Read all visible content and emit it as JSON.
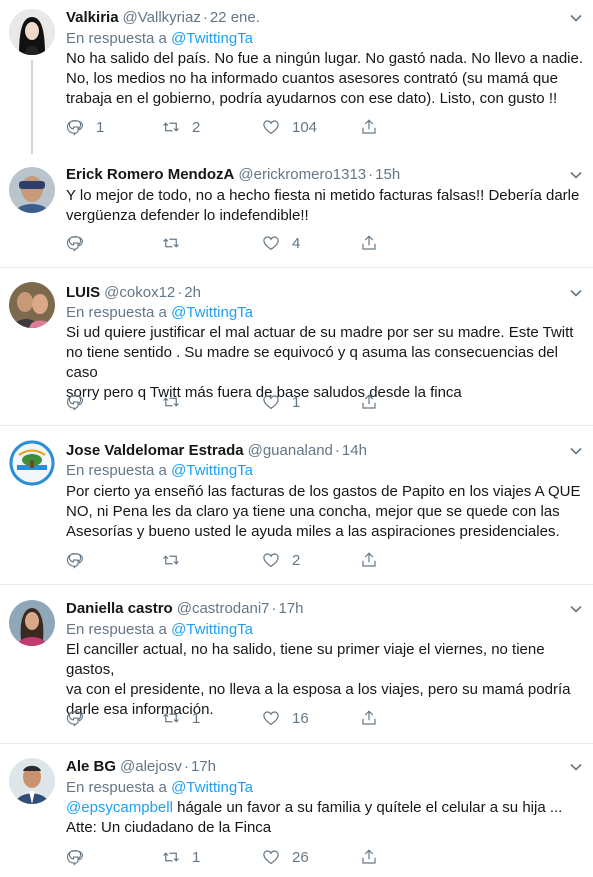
{
  "reply_prefix": "En respuesta a",
  "tweets": [
    {
      "name": "Valkiria",
      "handle": "@Vallkyriaz",
      "time": "22 ene.",
      "reply_to": "@TwittingTa",
      "text": "No ha salido del país. No fue a ningún lugar. No gastó nada. No llevo a nadie.\nNo, los medios no ha informado cuantos asesores contrató (su mamá que\ntrabaja en el gobierno, podría ayudarnos con ese dato). Listo, con gusto !!",
      "replies": "1",
      "retweets": "2",
      "likes": "104"
    },
    {
      "name": "Erick Romero MendozA",
      "handle": "@erickromero1313",
      "time": "15h",
      "text": "Y lo mejor de todo, no a hecho fiesta ni metido facturas falsas!! Debería darle\nvergüenza defender lo indefendible!!",
      "replies": "",
      "retweets": "",
      "likes": "4"
    },
    {
      "name": "LUIS",
      "handle": "@cokox12",
      "time": "2h",
      "reply_to": "@TwittingTa",
      "text": "Si ud quiere justificar el mal actuar de su madre por ser su madre. Este Twitt\nno tiene sentido . Su madre se equivocó y q asuma las consecuencias del caso\nsorry pero q Twitt más fuera de base saludos desde la finca",
      "replies": "",
      "retweets": "",
      "likes": "1"
    },
    {
      "name": "Jose Valdelomar Estrada",
      "handle": "@guanaland",
      "time": "14h",
      "reply_to": "@TwittingTa",
      "text": "Por cierto ya enseñó las facturas de los gastos de Papito en los viajes A QUE\nNO, ni Pena les da claro ya tiene una concha, mejor que se quede con las\nAsesorías y bueno usted le ayuda miles a las aspiraciones presidenciales.",
      "replies": "",
      "retweets": "",
      "likes": "2"
    },
    {
      "name": "Daniella castro",
      "handle": "@castrodani7",
      "time": "17h",
      "reply_to": "@TwittingTa",
      "text": "El canciller actual, no ha salido, tiene su primer viaje el viernes, no tiene gastos,\nva con el presidente, no lleva a la esposa a los viajes, pero su mamá podría\ndarle esa información.",
      "replies": "",
      "retweets": "1",
      "likes": "16"
    },
    {
      "name": "Ale BG",
      "handle": "@alejosv",
      "time": "17h",
      "reply_to": "@TwittingTa",
      "mention": "@epsycampbell",
      "text": " hágale un favor a su familia y quítele el celular a su hija ...\nAtte: Un ciudadano de la Finca",
      "replies": "",
      "retweets": "1",
      "likes": "26"
    }
  ],
  "colors": {
    "accent": "#1da1f2",
    "muted": "#657786",
    "text": "#14171a",
    "divider": "#e6ecf0"
  },
  "icons": [
    "reply-icon",
    "retweet-icon",
    "like-icon",
    "share-icon",
    "chevron-down-icon"
  ]
}
